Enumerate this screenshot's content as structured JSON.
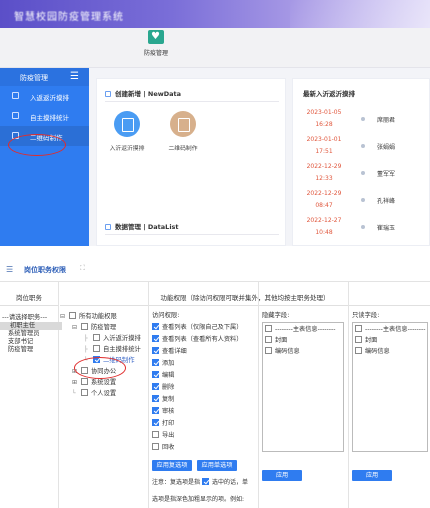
{
  "top": {
    "banner_title": "智慧校园防疫管理系统",
    "module_label": "防疫管理",
    "sidebar": {
      "title": "防疫管理",
      "menu_icon": "menu-icon",
      "items": [
        {
          "label": "入返返沂摸排",
          "icon": "person-icon"
        },
        {
          "label": "自主摸排统计",
          "icon": "chart-icon"
        },
        {
          "label": "二维码制作",
          "icon": "qrcode-icon"
        }
      ]
    },
    "new_data": {
      "title": "创建新增 | NewData",
      "actions": [
        {
          "label": "入沂返沂摸排",
          "icon": "form-icon",
          "color": "#4a9cf3"
        },
        {
          "label": "二维码制作",
          "icon": "qrcode-icon",
          "color": "#d7b08c"
        }
      ]
    },
    "data_list": {
      "title": "数据管理 | DataList"
    },
    "recent": {
      "title": "最新入沂返沂摸排",
      "entries": [
        {
          "date": "2023-01-05",
          "time": "16:28",
          "name": "席丽君"
        },
        {
          "date": "2023-01-01",
          "time": "17:51",
          "name": "张娟娟"
        },
        {
          "date": "2022-12-29",
          "time": "12:33",
          "name": "董军军"
        },
        {
          "date": "2022-12-29",
          "time": "08:47",
          "name": "孔祥峰"
        },
        {
          "date": "2022-12-27",
          "time": "10:48",
          "name": "崔瑞玉"
        }
      ]
    }
  },
  "bottom": {
    "tab_label": "岗位职务权限",
    "headers": {
      "roles": "岗位职务",
      "perms": "功能权限（除访问权限可联并集外，其他均按主职务处理）"
    },
    "roles": [
      {
        "label": "---请选择职务---",
        "selected": false
      },
      {
        "label": "初职主任",
        "selected": true
      },
      {
        "label": "系统管理员",
        "selected": false
      },
      {
        "label": "支部书记",
        "selected": false
      },
      {
        "label": "防疫管理",
        "selected": false
      }
    ],
    "tree": {
      "root": "所有功能权限",
      "group": "防疫管理",
      "children": [
        "入沂返沂摸排",
        "自主摸排统计",
        "二维码制作"
      ],
      "siblings": [
        "协同办公",
        "系统设置",
        "个人设置"
      ]
    },
    "access": {
      "title": "访问权限:",
      "items": [
        {
          "label": "查看列表（仅限自己及下属）",
          "checked": true
        },
        {
          "label": "查看列表（查看所有人资料）",
          "checked": true
        },
        {
          "label": "查看详细",
          "checked": true
        },
        {
          "label": "添加",
          "checked": true
        },
        {
          "label": "编辑",
          "checked": true
        },
        {
          "label": "删除",
          "checked": true
        },
        {
          "label": "复制",
          "checked": true
        },
        {
          "label": "审核",
          "checked": true
        },
        {
          "label": "打印",
          "checked": true
        },
        {
          "label": "导出",
          "checked": false
        },
        {
          "label": "回收",
          "checked": false
        }
      ],
      "apply_multi": "应用复选项",
      "apply_single": "应用单选项",
      "note_1": "注意：复选项是指",
      "note_2": "选中的话，单",
      "note_3": "选项是指深色加粗显示的项。例如:"
    },
    "hidden": {
      "title": "隐藏字段:",
      "items": [
        "--------主表信息--------",
        "封面",
        "编码信息"
      ],
      "apply": "应用"
    },
    "readonly": {
      "title": "只读字段:",
      "items": [
        "--------主表信息--------",
        "封面",
        "编码信息"
      ],
      "apply": "应用"
    }
  }
}
